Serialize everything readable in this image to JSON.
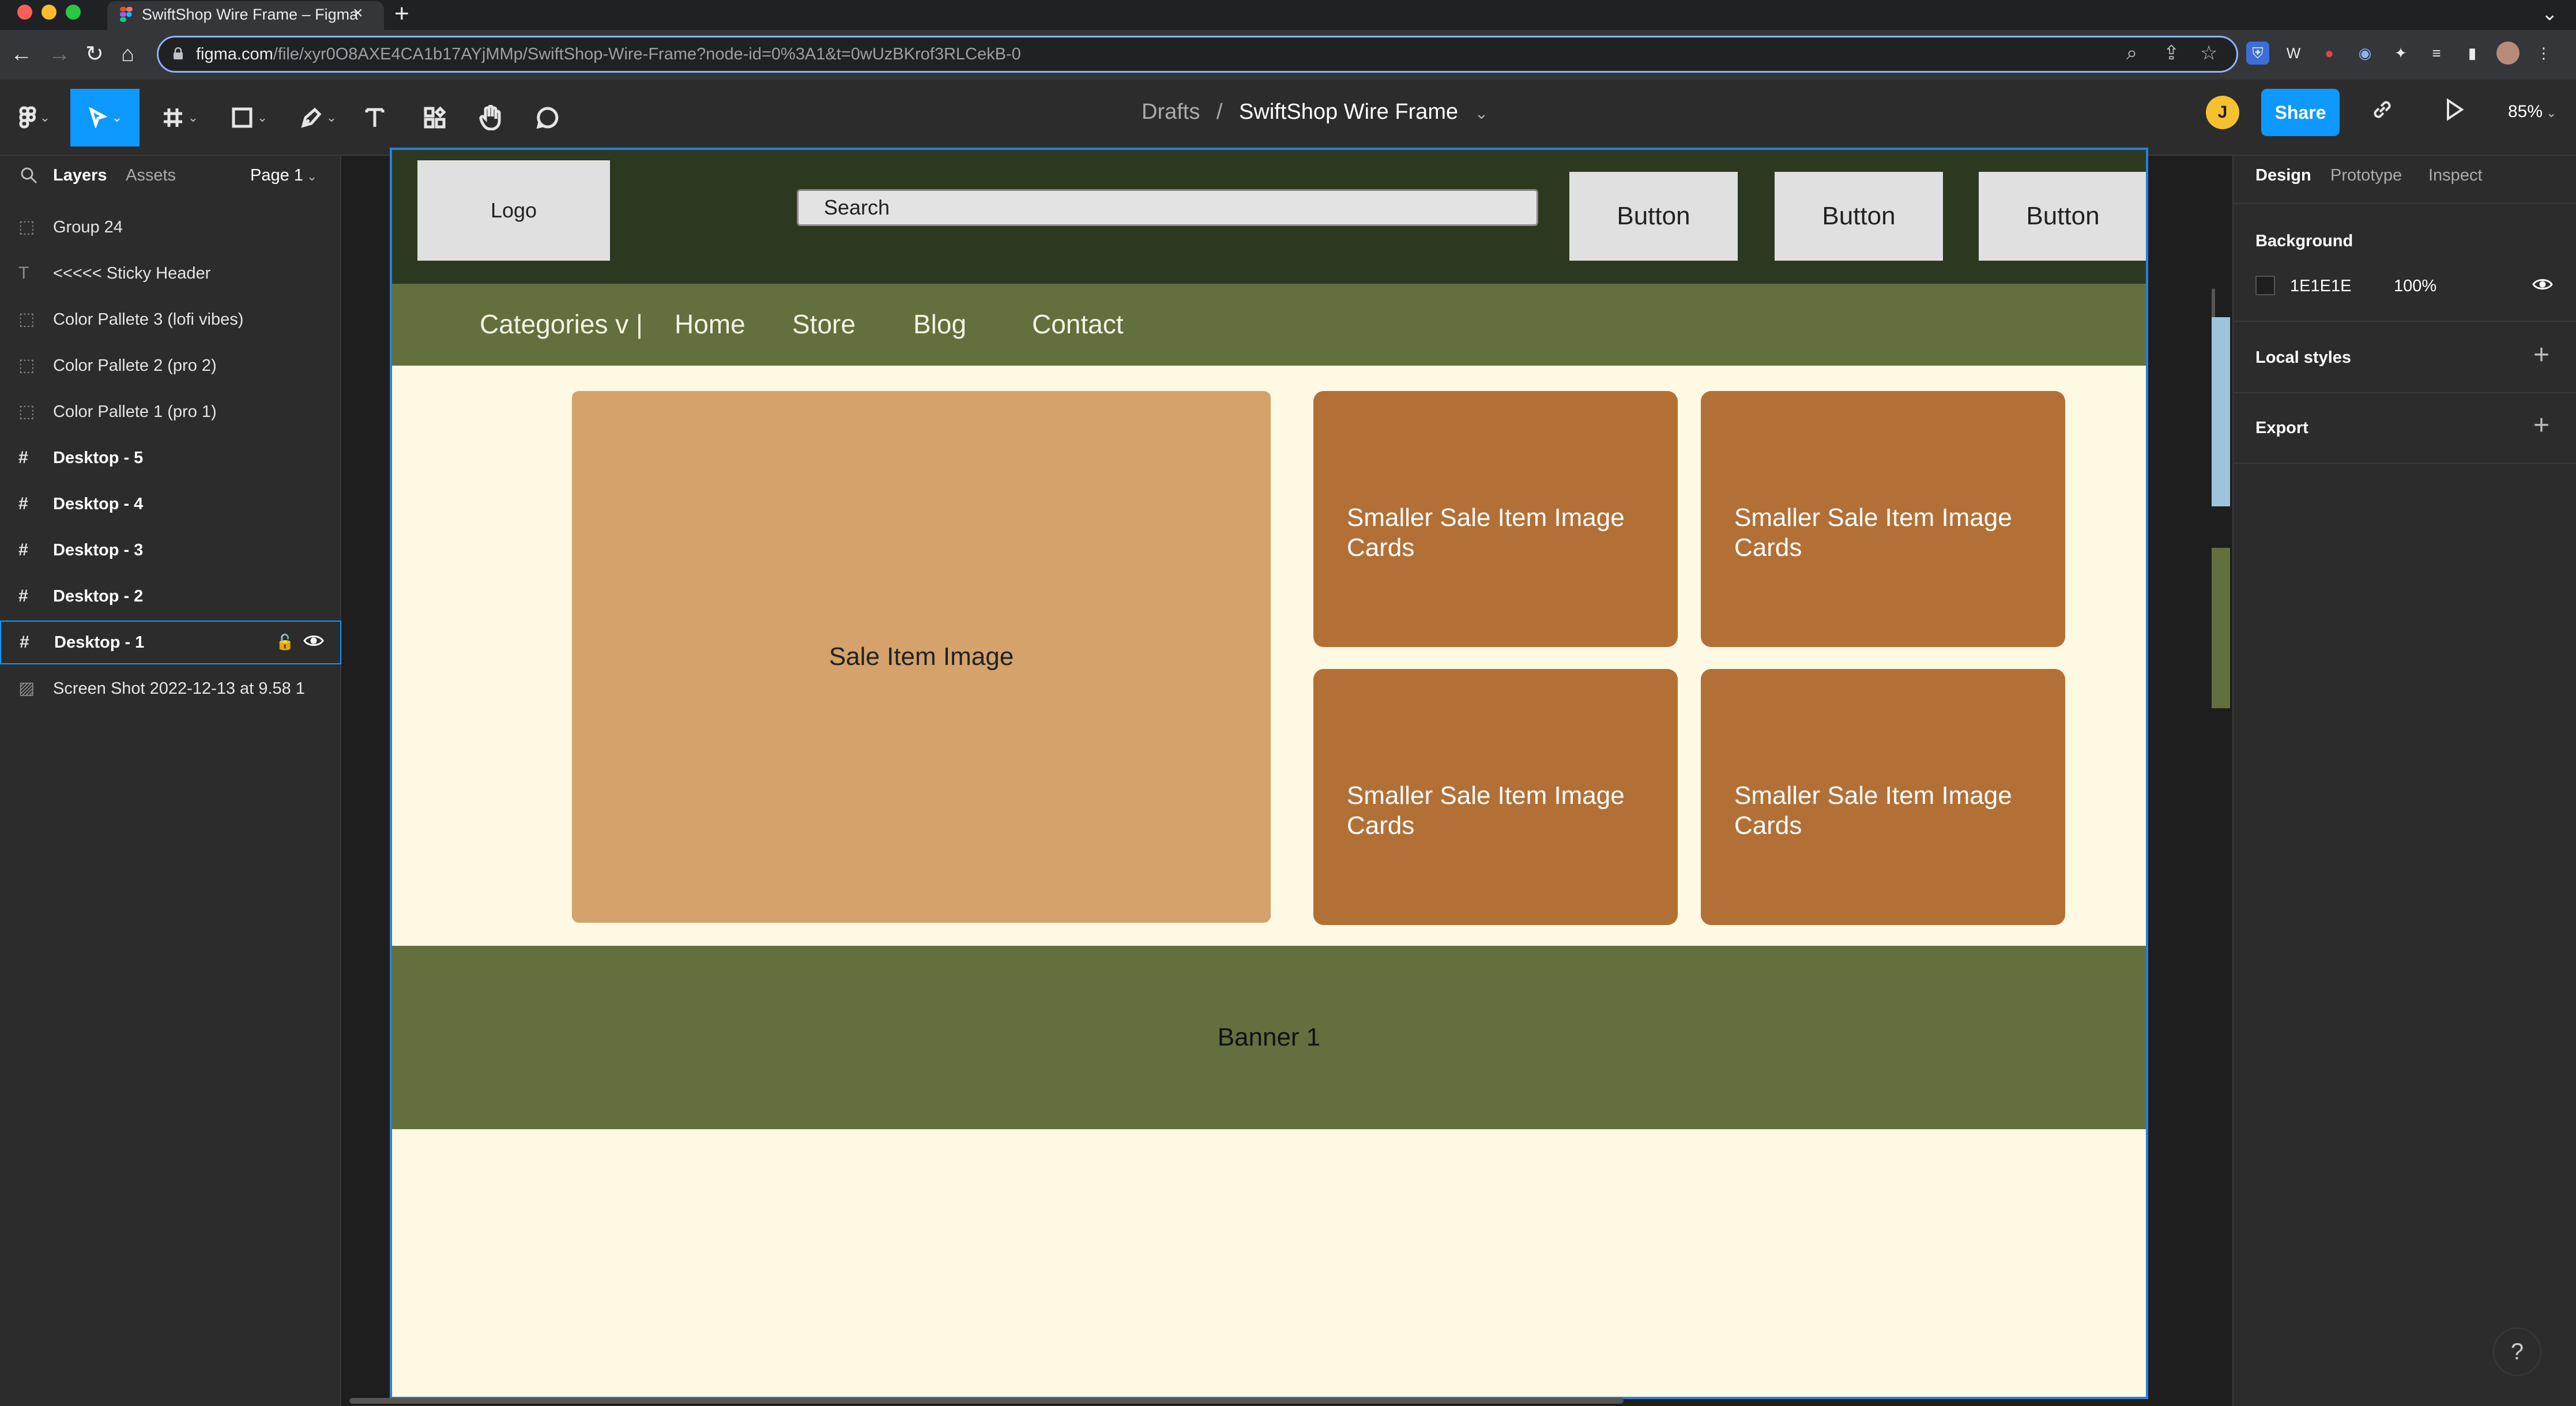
{
  "browser": {
    "tab_title": "SwiftShop Wire Frame – Figma",
    "tab_close": "×",
    "new_tab": "+",
    "url_host": "figma.com",
    "url_path": "/file/xyr0O8AXE4CA1b17AYjMMp/SwiftShop-Wire-Frame?node-id=0%3A1&t=0wUzBKrof3RLCekB-0",
    "traffic_colors": [
      "#ff5f57",
      "#febc2e",
      "#28c840"
    ],
    "extensions": [
      "W",
      "●",
      "◉"
    ]
  },
  "figma_toolbar": {
    "breadcrumb_drafts": "Drafts",
    "breadcrumb_sep": "/",
    "file_name": "SwiftShop Wire Frame",
    "avatar_initial": "J",
    "share_label": "Share",
    "zoom": "85%",
    "accent": "#0d99ff"
  },
  "layers_panel": {
    "tab_layers": "Layers",
    "tab_assets": "Assets",
    "page": "Page 1",
    "items": [
      {
        "label": "Group 24",
        "icon": "group-icon"
      },
      {
        "label": "<<<<< Sticky Header",
        "icon": "text-icon"
      },
      {
        "label": "Color Pallete 3 (lofi vibes)",
        "icon": "group-icon"
      },
      {
        "label": "Color Pallete 2 (pro 2)",
        "icon": "group-icon"
      },
      {
        "label": "Color Pallete 1 (pro 1)",
        "icon": "group-icon"
      },
      {
        "label": "Desktop - 5",
        "icon": "frame-icon"
      },
      {
        "label": "Desktop - 4",
        "icon": "frame-icon"
      },
      {
        "label": "Desktop - 3",
        "icon": "frame-icon"
      },
      {
        "label": "Desktop - 2",
        "icon": "frame-icon"
      },
      {
        "label": "Desktop - 1",
        "icon": "frame-icon",
        "selected": true
      },
      {
        "label": "Screen Shot 2022-12-13 at 9.58 1",
        "icon": "image-icon"
      }
    ]
  },
  "wireframe": {
    "logo": "Logo",
    "search": "Search",
    "buttons": [
      "Button",
      "Button",
      "Button"
    ],
    "nav": [
      "Categories v |",
      "Home",
      "Store",
      "Blog",
      "Contact"
    ],
    "sale_main": "Sale Item Image",
    "cards": [
      "Smaller Sale Item Image Cards",
      "Smaller Sale Item Image Cards",
      "Smaller Sale Item Image Cards",
      "Smaller Sale Item Image Cards"
    ],
    "banner": "Banner 1",
    "colors": {
      "header": "#2c3820",
      "nav": "#636f3c",
      "background": "#fdf9e3",
      "sale_main": "#d4a26a",
      "card": "#b27036"
    }
  },
  "design_panel": {
    "tab_design": "Design",
    "tab_prototype": "Prototype",
    "tab_inspect": "Inspect",
    "background_title": "Background",
    "background_hex": "1E1E1E",
    "background_opacity": "100%",
    "local_styles": "Local styles",
    "export": "Export",
    "add": "+",
    "help": "?"
  }
}
